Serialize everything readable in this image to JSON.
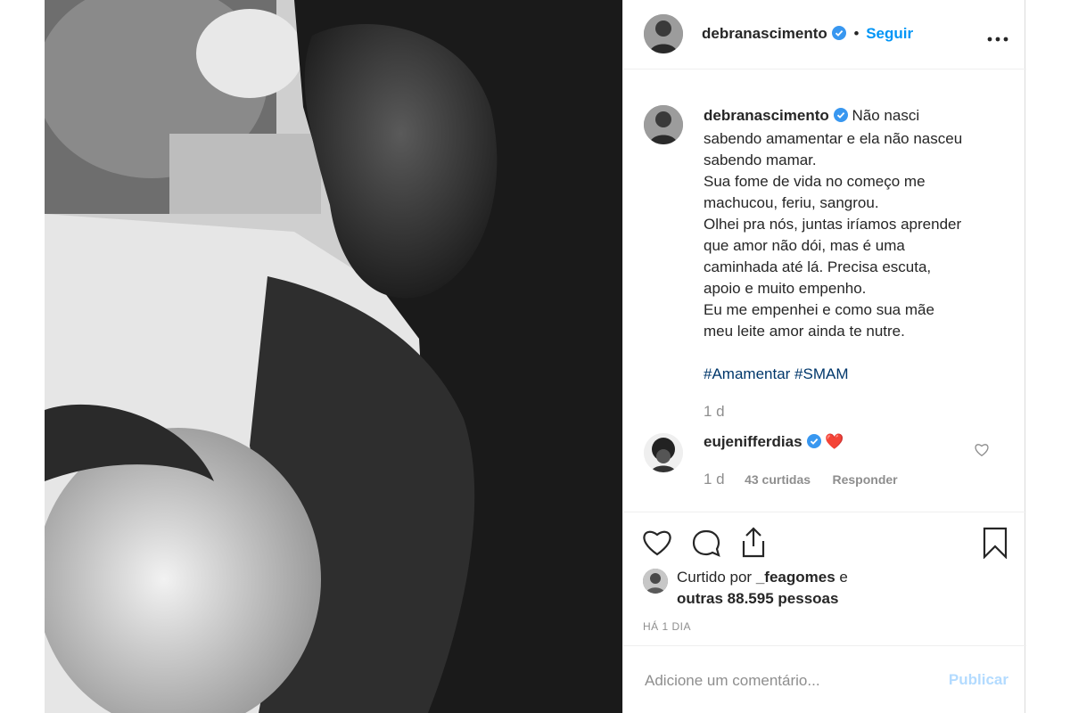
{
  "post_header": {
    "username": "debranascimento",
    "separator": "•",
    "follow_label": "Seguir",
    "more_icon": "more-horizontal-icon"
  },
  "caption": {
    "username": "debranascimento",
    "lines": [
      "Não nasci",
      "sabendo amamentar e ela não nasceu",
      "sabendo mamar.",
      "Sua fome de vida no começo me",
      "machucou, feriu, sangrou.",
      "Olhei pra nós, juntas iríamos aprender",
      "que amor não dói, mas é uma",
      "caminhada até lá. Precisa escuta,",
      "apoio e muito empenho.",
      "Eu me empenhei e como sua mãe",
      "meu leite amor ainda te nutre."
    ],
    "hashtags": "#Amamentar #SMAM",
    "age": "1 d"
  },
  "comment": {
    "username": "eujenifferdias",
    "emoji": "❤️",
    "age": "1 d",
    "likes": "43 curtidas",
    "reply_label": "Responder"
  },
  "likes": {
    "prefix": "Curtido por ",
    "user": "_feagomes",
    "mid": " e",
    "others": "outras 88.595 pessoas"
  },
  "timestamp": "HÁ 1 DIA",
  "add_comment": {
    "placeholder": "Adicione um comentário...",
    "publish_label": "Publicar"
  },
  "colors": {
    "accent": "#0095f6",
    "verified": "#3897f0",
    "hashtag": "#00376b",
    "muted": "#8e8e8e"
  }
}
